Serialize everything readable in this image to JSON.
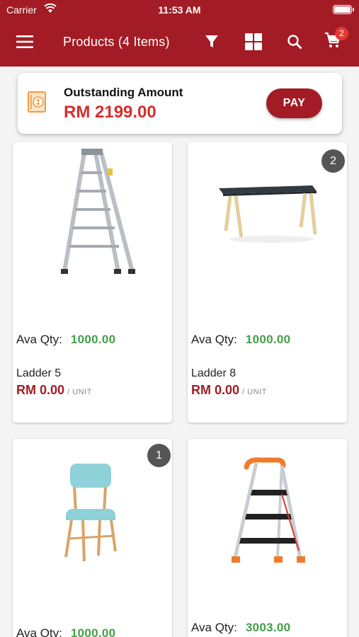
{
  "status_bar": {
    "carrier": "Carrier",
    "time": "11:53 AM"
  },
  "navbar": {
    "title": "Products (4 Items)",
    "cart_count": "2",
    "icons": [
      "menu-icon",
      "filter-icon",
      "grid-view-icon",
      "search-icon",
      "cart-icon"
    ]
  },
  "outstanding": {
    "label": "Outstanding Amount",
    "amount": "RM 2199.00",
    "pay_label": "PAY"
  },
  "products": [
    {
      "name": "Ladder 5",
      "ava_label": "Ava Qty:",
      "ava_qty": "1000.00",
      "price": "RM 0.00",
      "unit": "/ UNIT",
      "badge": "",
      "image": "ladder-image"
    },
    {
      "name": "Ladder 8",
      "ava_label": "Ava Qty:",
      "ava_qty": "1000.00",
      "price": "RM 0.00",
      "unit": "/ UNIT",
      "badge": "2",
      "image": "table-image"
    },
    {
      "name": "",
      "ava_label": "Ava Qty:",
      "ava_qty": "1000.00",
      "price": "",
      "unit": "",
      "badge": "1",
      "image": "chair-image"
    },
    {
      "name": "",
      "ava_label": "Ava Qty:",
      "ava_qty": "3003.00",
      "price": "",
      "unit": "",
      "badge": "",
      "image": "step-ladder-image"
    }
  ],
  "colors": {
    "brand": "#a31c25",
    "price": "#d32f2f",
    "qty": "#43a047",
    "badge": "#555555"
  }
}
